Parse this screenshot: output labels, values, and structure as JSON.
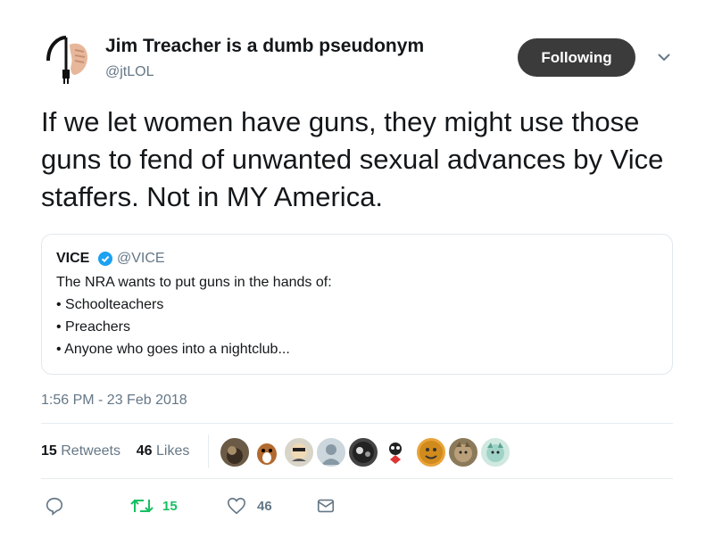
{
  "author": {
    "display_name": "Jim Treacher is a dumb pseudonym",
    "handle": "@jtLOL",
    "avatar_icon": "hand-holding-plug-avatar"
  },
  "follow_button": {
    "label": "Following"
  },
  "tweet": {
    "text": "If we let women have guns, they might use those guns to fend of unwanted sexual advances by Vice staffers. Not in MY America.",
    "timestamp": "1:56 PM - 23 Feb 2018"
  },
  "quoted_tweet": {
    "display_name": "VICE",
    "handle": "@VICE",
    "verified_icon": "verified-badge-icon",
    "lines": [
      "The NRA wants to put guns in the hands of:",
      "• Schoolteachers",
      "• Preachers",
      "• Anyone who goes into a nightclub..."
    ]
  },
  "stats": {
    "retweets_count": "15",
    "retweets_label": "Retweets",
    "likes_count": "46",
    "likes_label": "Likes"
  },
  "actions": {
    "reply_icon": "reply-icon",
    "retweet_icon": "retweet-icon",
    "retweet_count": "15",
    "like_icon": "heart-icon",
    "like_count": "46",
    "dm_icon": "envelope-icon"
  },
  "colors": {
    "text": "#14171a",
    "secondary": "#657786",
    "retweet_green": "#17bf63",
    "verified_blue": "#1da1f2",
    "follow_bg": "#3b3b3b"
  }
}
